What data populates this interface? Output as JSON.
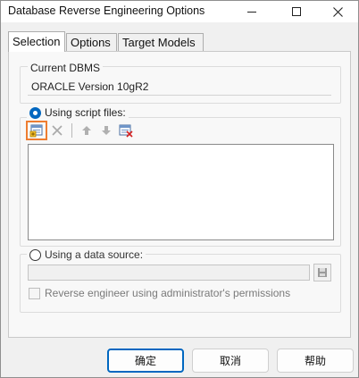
{
  "window": {
    "title": "Database Reverse Engineering Options"
  },
  "tabs": [
    {
      "label": "Selection",
      "active": true
    },
    {
      "label": "Options",
      "active": false
    },
    {
      "label": "Target Models",
      "active": false
    }
  ],
  "current_dbms": {
    "label": "Current DBMS",
    "value": "ORACLE Version 10gR2"
  },
  "script_files": {
    "label": "Using script files:",
    "selected": true,
    "toolbar": [
      {
        "icon": "add-files-icon",
        "highlighted": true
      },
      {
        "icon": "delete-icon"
      },
      {
        "icon": "move-up-icon"
      },
      {
        "icon": "move-down-icon"
      },
      {
        "icon": "clear-list-icon"
      }
    ]
  },
  "data_source": {
    "label": "Using a data source:",
    "selected": false,
    "value": "",
    "admin_permissions_label": "Reverse engineer using administrator's permissions",
    "admin_permissions_checked": false
  },
  "buttons": {
    "ok": "确定",
    "cancel": "取消",
    "help": "帮助"
  },
  "colors": {
    "accent": "#0067c0",
    "highlight": "#ee7d31"
  }
}
